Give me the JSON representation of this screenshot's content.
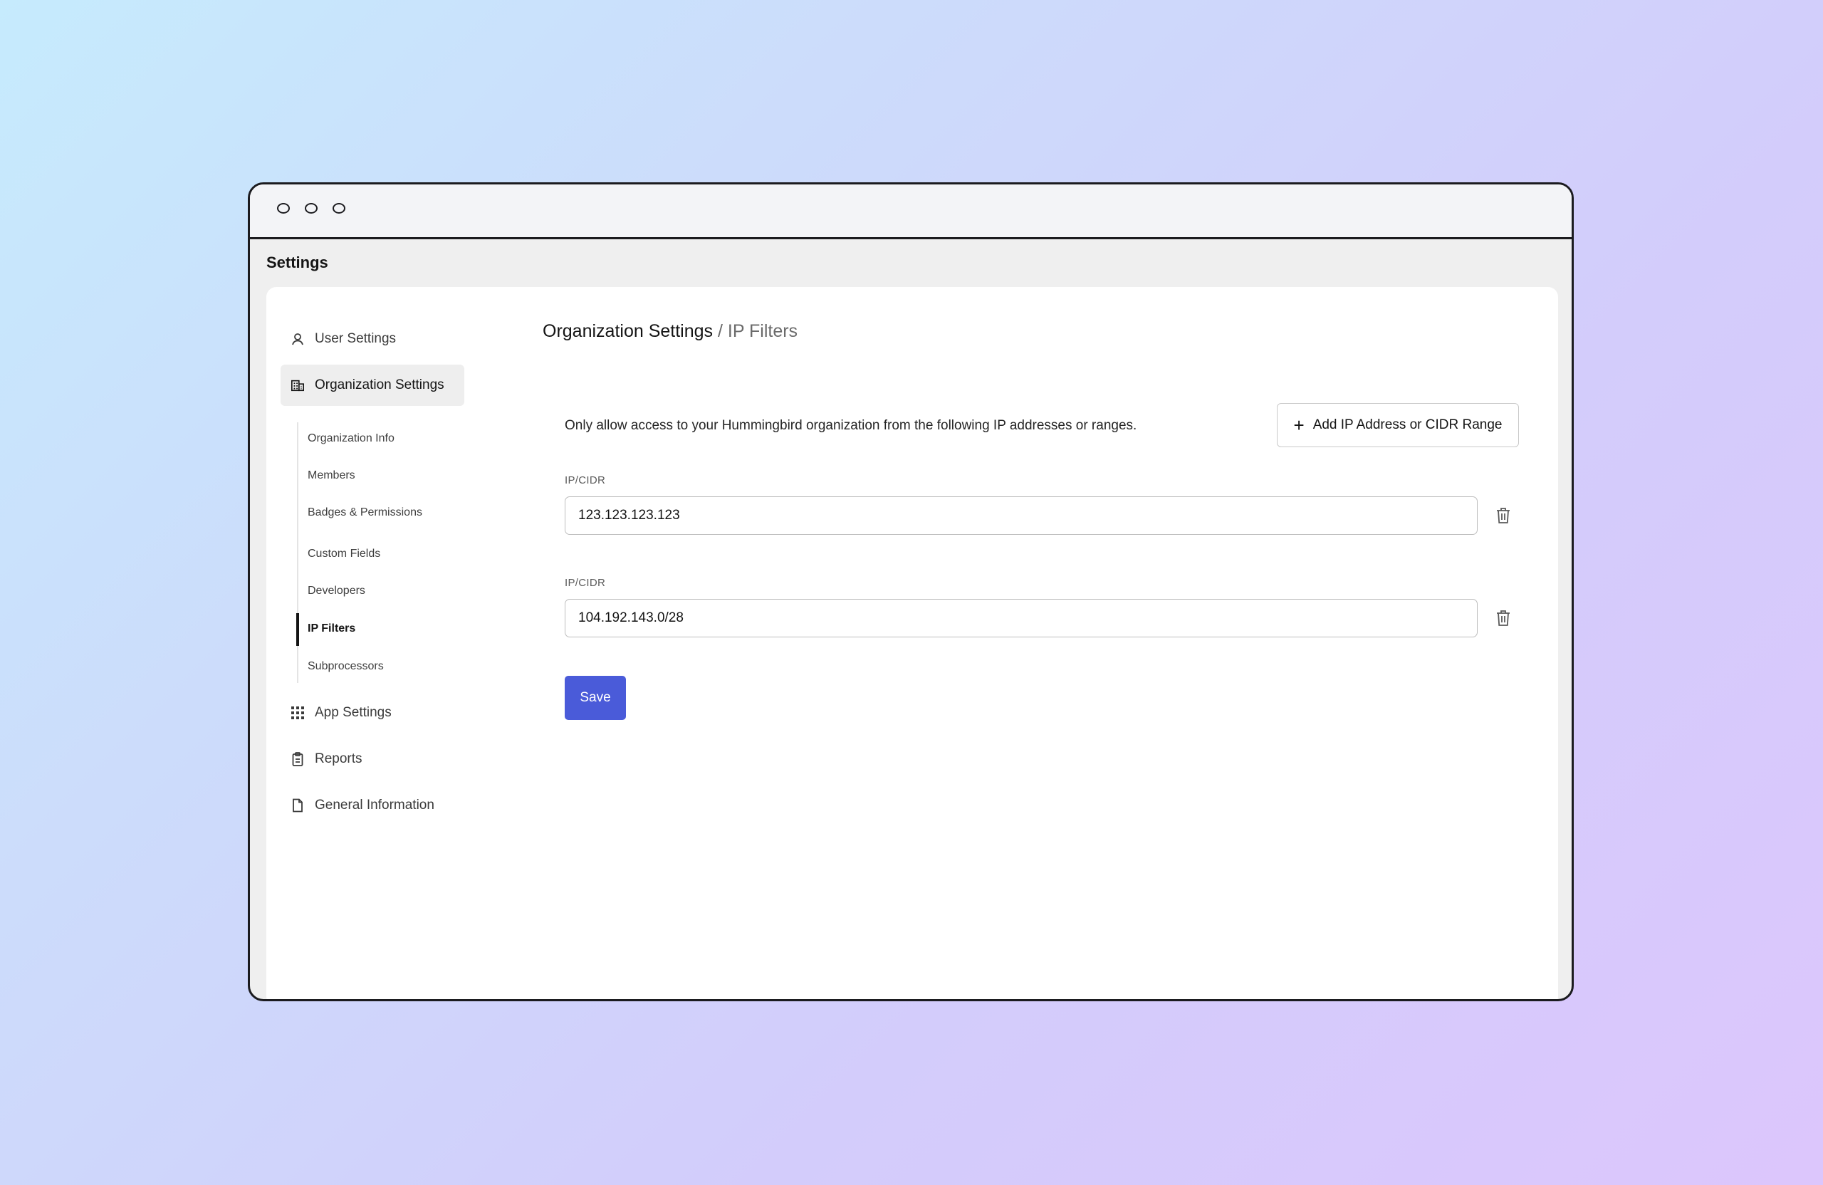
{
  "app": {
    "title": "Settings"
  },
  "sidebar": {
    "items": [
      {
        "label": "User Settings",
        "icon": "user-icon"
      },
      {
        "label": "Organization Settings",
        "icon": "building-icon"
      },
      {
        "label": "App Settings",
        "icon": "grid-icon"
      },
      {
        "label": "Reports",
        "icon": "clipboard-icon"
      },
      {
        "label": "General Information",
        "icon": "document-icon"
      }
    ],
    "sub_items": [
      "Organization Info",
      "Members",
      "Badges & Permissions",
      "Custom Fields",
      "Developers",
      "IP Filters",
      "Subprocessors"
    ]
  },
  "main": {
    "breadcrumb": {
      "parent": "Organization Settings",
      "separator": "/",
      "current": "IP Filters"
    },
    "description": "Only allow access to your Hummingbird organization from the following IP addresses or ranges.",
    "add_button_label": "Add IP Address or CIDR Range",
    "fields": [
      {
        "label": "IP/CIDR",
        "value": "123.123.123.123"
      },
      {
        "label": "IP/CIDR",
        "value": "104.192.143.0/28"
      }
    ],
    "save_label": "Save"
  },
  "colors": {
    "accent": "#4a5bd9",
    "active_bg": "#eeeeee"
  }
}
